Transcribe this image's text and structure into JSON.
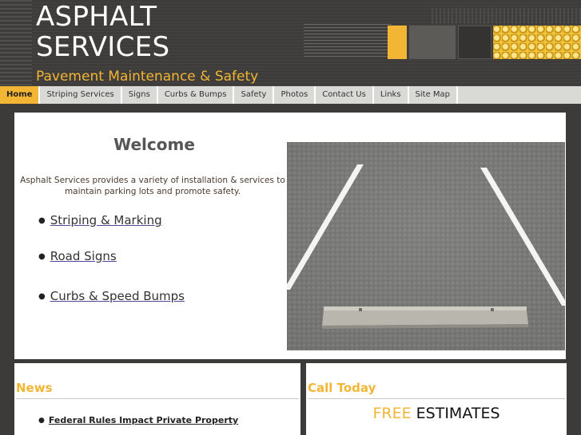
{
  "header": {
    "title_line1": "ASPHALT",
    "title_line2": "SERVICES",
    "tagline": "Pavement Maintenance & Safety"
  },
  "nav": {
    "items": [
      {
        "label": "Home",
        "active": true
      },
      {
        "label": "Striping Services",
        "active": false
      },
      {
        "label": "Signs",
        "active": false
      },
      {
        "label": "Curbs & Bumps",
        "active": false
      },
      {
        "label": "Safety",
        "active": false
      },
      {
        "label": "Photos",
        "active": false
      },
      {
        "label": "Contact Us",
        "active": false
      },
      {
        "label": "Links",
        "active": false
      },
      {
        "label": "Site Map",
        "active": false
      }
    ]
  },
  "main": {
    "heading": "Welcome",
    "intro": "Asphalt Services provides a variety of installation & services to maintain parking lots and promote safety.",
    "services": [
      {
        "label": "Striping & Marking"
      },
      {
        "label": "Road Signs"
      },
      {
        "label": "Curbs & Speed Bumps"
      }
    ]
  },
  "news": {
    "title": "News",
    "items": [
      {
        "label": "Federal Rules Impact Private Property"
      }
    ]
  },
  "call": {
    "title": "Call Today",
    "estimates_free": "FREE",
    "estimates_rest": "ESTIMATES"
  },
  "colors": {
    "accent": "#f2b534",
    "background": "#3c3b39",
    "nav_bg": "#d9d9d6",
    "panel_bg": "#ffffff"
  },
  "icons": {
    "bullet": "bullet-dot-icon"
  }
}
